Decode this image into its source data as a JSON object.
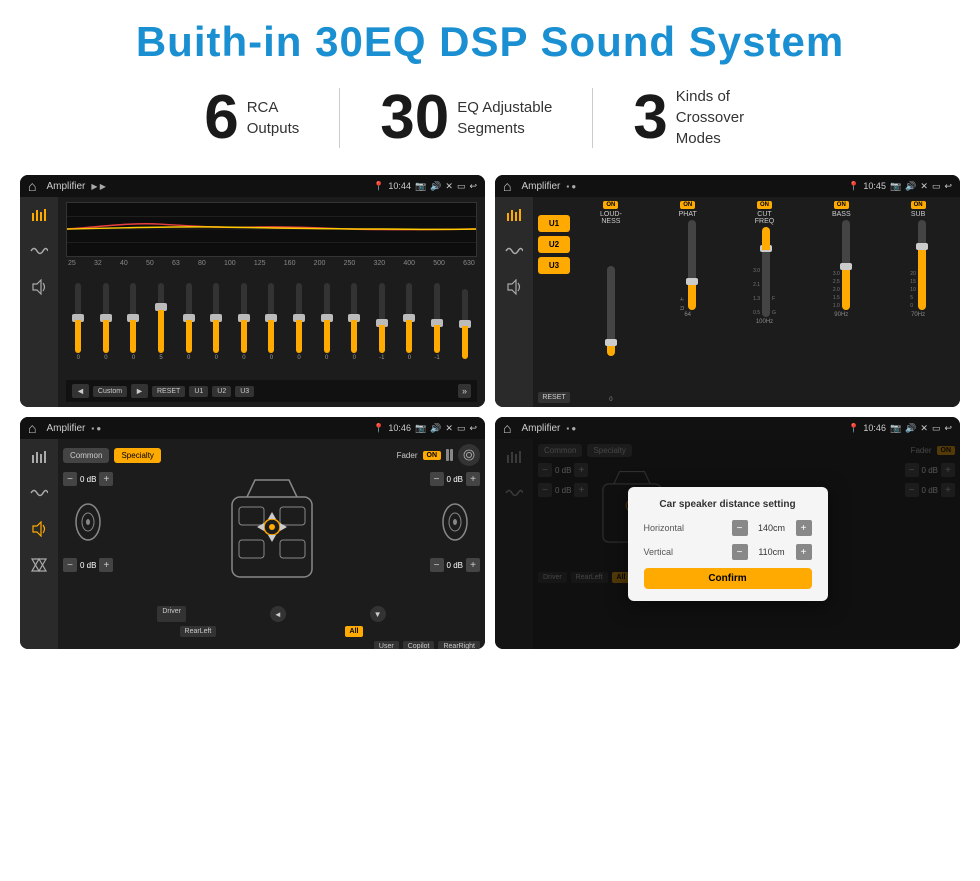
{
  "header": {
    "title": "Buith-in 30EQ DSP Sound System"
  },
  "stats": [
    {
      "number": "6",
      "label": "RCA\nOutputs"
    },
    {
      "number": "30",
      "label": "EQ Adjustable\nSegments"
    },
    {
      "number": "3",
      "label": "Kinds of\nCrossover Modes"
    }
  ],
  "screens": [
    {
      "id": "eq-screen",
      "app_name": "Amplifier",
      "time": "10:44",
      "type": "eq"
    },
    {
      "id": "crossover-screen",
      "app_name": "Amplifier",
      "time": "10:45",
      "type": "crossover"
    },
    {
      "id": "fader-screen",
      "app_name": "Amplifier",
      "time": "10:46",
      "type": "fader"
    },
    {
      "id": "distance-screen",
      "app_name": "Amplifier",
      "time": "10:46",
      "type": "distance",
      "dialog": {
        "title": "Car speaker distance setting",
        "horizontal_label": "Horizontal",
        "horizontal_value": "140cm",
        "vertical_label": "Vertical",
        "vertical_value": "110cm",
        "confirm_label": "Confirm"
      }
    }
  ],
  "eq": {
    "freq_labels": [
      "25",
      "32",
      "40",
      "50",
      "63",
      "80",
      "100",
      "125",
      "160",
      "200",
      "250",
      "320",
      "400",
      "500",
      "630"
    ],
    "values": [
      "0",
      "0",
      "0",
      "5",
      "0",
      "0",
      "0",
      "0",
      "0",
      "0",
      "0",
      "-1",
      "0",
      "-1"
    ],
    "preset": "Custom",
    "buttons": [
      "RESET",
      "U1",
      "U2",
      "U3"
    ]
  },
  "crossover": {
    "channels": [
      "U1",
      "U2",
      "U3"
    ],
    "controls": [
      "LOUDNESS",
      "PHAT",
      "CUT FREQ",
      "BASS",
      "SUB"
    ],
    "reset_label": "RESET"
  },
  "fader": {
    "tabs": [
      "Common",
      "Specialty"
    ],
    "fader_label": "Fader",
    "on_label": "ON",
    "db_values": [
      "0 dB",
      "0 dB",
      "0 dB",
      "0 dB"
    ],
    "buttons": [
      "Driver",
      "RearLeft",
      "All",
      "User",
      "Copilot",
      "RearRight"
    ]
  },
  "distance_dialog": {
    "title": "Car speaker distance setting",
    "horizontal_label": "Horizontal",
    "horizontal_value": "140cm",
    "vertical_label": "Vertical",
    "vertical_value": "110cm",
    "confirm_label": "Confirm"
  }
}
